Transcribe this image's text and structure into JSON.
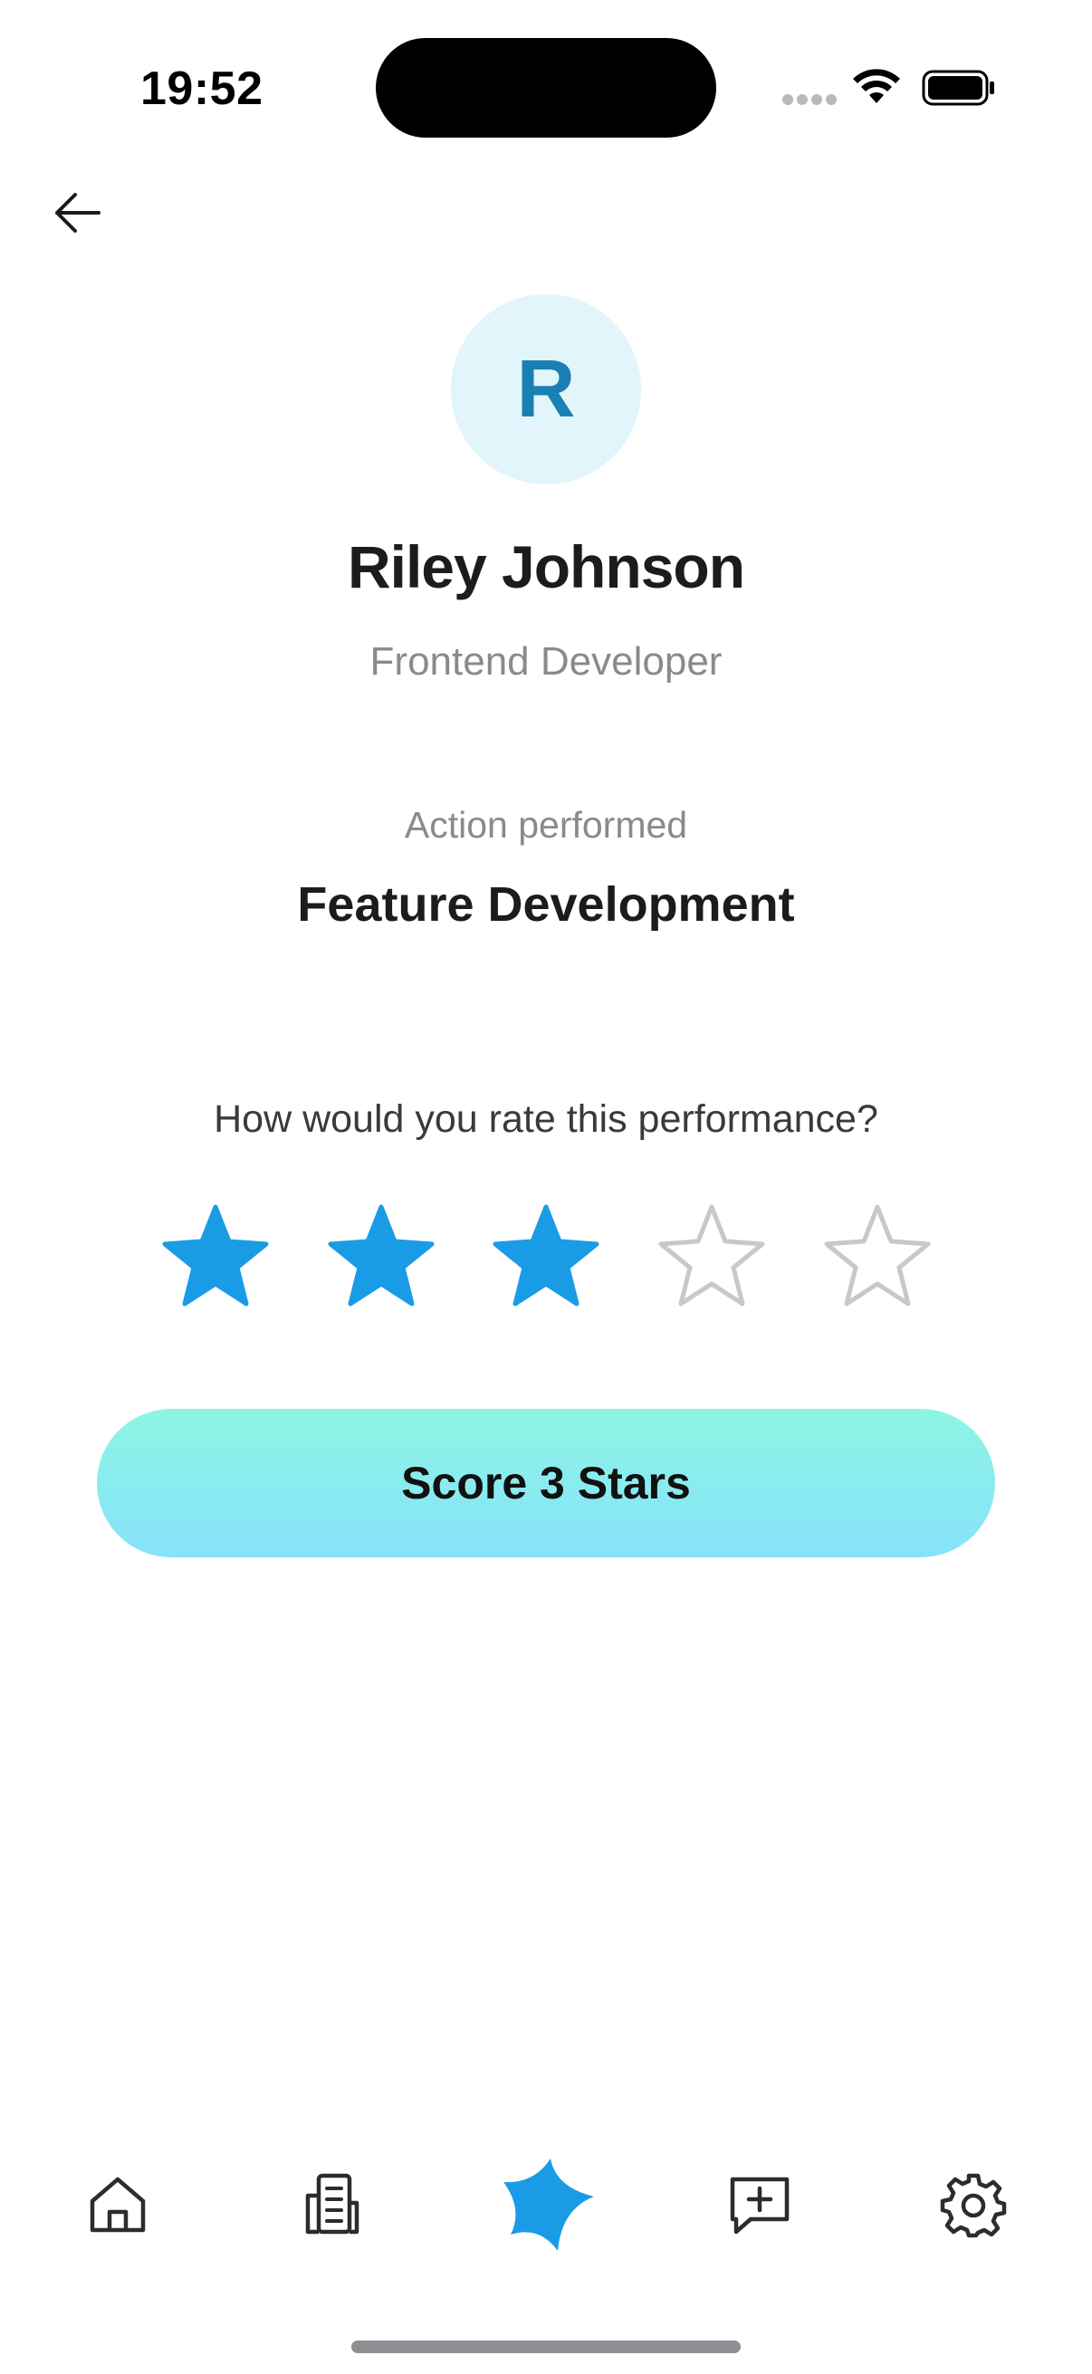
{
  "status_bar": {
    "time": "19:52"
  },
  "navigation": {
    "back_icon": "arrow-left-icon"
  },
  "profile": {
    "initial": "R",
    "name": "Riley Johnson",
    "role": "Frontend Developer"
  },
  "action": {
    "caption": "Action performed",
    "value": "Feature Development"
  },
  "rating": {
    "question": "How would you rate this performance?",
    "selected": 3,
    "max": 5,
    "active_color": "#1a9be6",
    "inactive_color": "#c7c7cc"
  },
  "submit": {
    "label": "Score 3 Stars"
  },
  "tab_bar": {
    "items": [
      {
        "icon": "home-icon"
      },
      {
        "icon": "building-icon"
      },
      {
        "icon": "sparkle-star-icon",
        "active": true
      },
      {
        "icon": "message-plus-icon"
      },
      {
        "icon": "gear-icon"
      }
    ]
  },
  "colors": {
    "accent": "#1a9be6",
    "avatar_bg": "#e1f5fb",
    "avatar_text": "#1a7fb3",
    "button_gradient_top": "#8ef5e3",
    "button_gradient_bottom": "#86e2fb"
  }
}
